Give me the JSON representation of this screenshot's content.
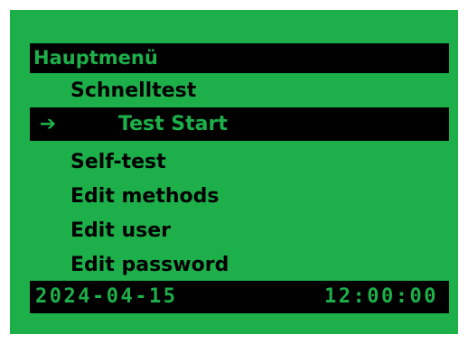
{
  "menu": {
    "title": "Hauptmenü",
    "items": [
      {
        "label": "Schnelltest",
        "selected": false
      },
      {
        "label": "Test Start",
        "selected": true
      },
      {
        "label": "Self-test",
        "selected": false
      },
      {
        "label": "Edit methods",
        "selected": false
      },
      {
        "label": "Edit user",
        "selected": false
      },
      {
        "label": "Edit password",
        "selected": false
      }
    ],
    "selection_icon": "arrow-right-icon"
  },
  "status": {
    "date": "2024-04-15",
    "time": "12:00:00"
  },
  "colors": {
    "screen_background": "#1db04a",
    "bar_background": "#000000"
  }
}
